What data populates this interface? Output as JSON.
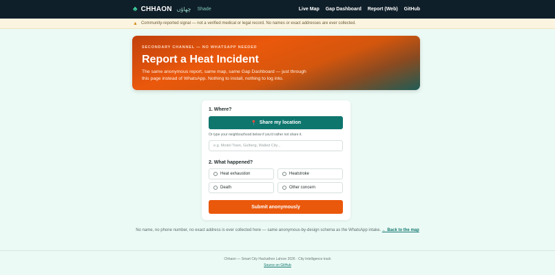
{
  "nav": {
    "brand_icon": "leaf-icon",
    "brand_name": "CHHAON",
    "brand_urdu": "چھاؤں",
    "brand_sub": "Shade",
    "links": [
      "Live Map",
      "Gap Dashboard",
      "Report (Web)",
      "GitHub"
    ]
  },
  "notice": {
    "icon": "warning-icon",
    "text": "Community-reported signal — not a verified medical or legal record. No names or exact addresses are ever collected."
  },
  "hero": {
    "eyebrow": "SECONDARY CHANNEL — NO WHATSAPP NEEDED",
    "title": "Report a Heat Incident",
    "desc": "The same anonymous report, same map, same Gap Dashboard — just through this page instead of WhatsApp. Nothing to install, nothing to log into."
  },
  "form": {
    "where_title": "1. Where?",
    "share_icon": "pin-icon",
    "share_label": "Share my location",
    "helper": "Or type your neighbourhood below if you'd rather not share it.",
    "neighbourhood_value": "",
    "neighbourhood_placeholder": "e.g. Model Town, Gulberg, Walled City...",
    "what_title": "2. What happened?",
    "options": [
      "Heat exhaustion",
      "Heatstroke",
      "Death",
      "Other concern"
    ],
    "submit_label": "Submit anonymously"
  },
  "note": {
    "text": "No name, no phone number, no exact address is ever collected here — same anonymous-by-design schema as the WhatsApp intake.",
    "link": "← Back to the map"
  },
  "footer": {
    "text": "Chhaon — Smart City Hackathon Lahore 2026 · City Intelligence track",
    "link": "Source on GitHub"
  },
  "colors": {
    "nav_bg": "#0f1f2a",
    "accent_teal": "#0f766e",
    "accent_orange": "#ea580c",
    "page_bg": "#ecfaf5"
  }
}
